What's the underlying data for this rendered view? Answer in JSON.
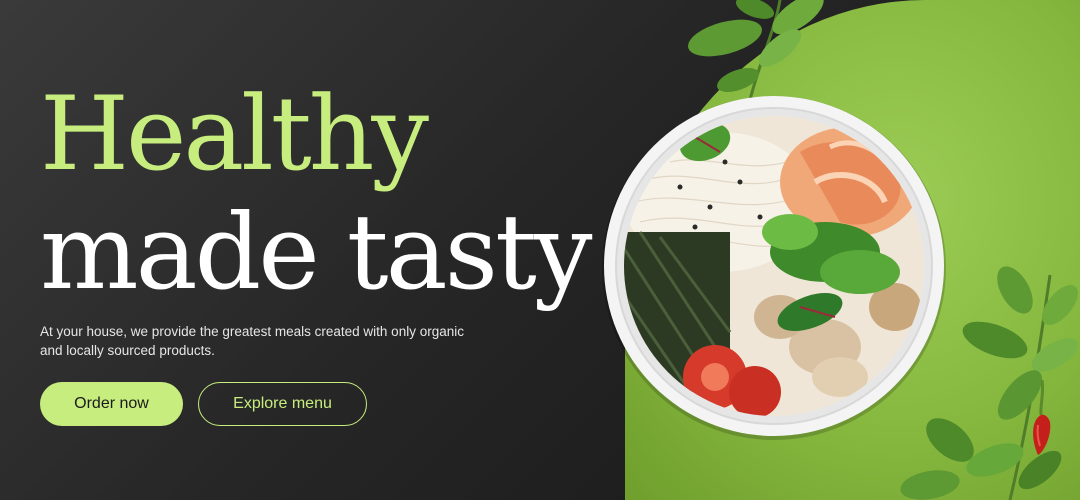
{
  "hero": {
    "headline_line1": "Healthy",
    "headline_line2": "made tasty",
    "description": "At your house, we provide the greatest meals created with only organic and locally sourced products.",
    "primary_button": "Order now",
    "secondary_button": "Explore menu"
  },
  "colors": {
    "accent": "#c7ed7e",
    "background": "#262626",
    "green_panel": "#8fc04a"
  },
  "icons": {
    "bowl": "food-bowl-image",
    "leaves": "basil-leaf-icon",
    "pepper": "chili-pepper-icon"
  }
}
